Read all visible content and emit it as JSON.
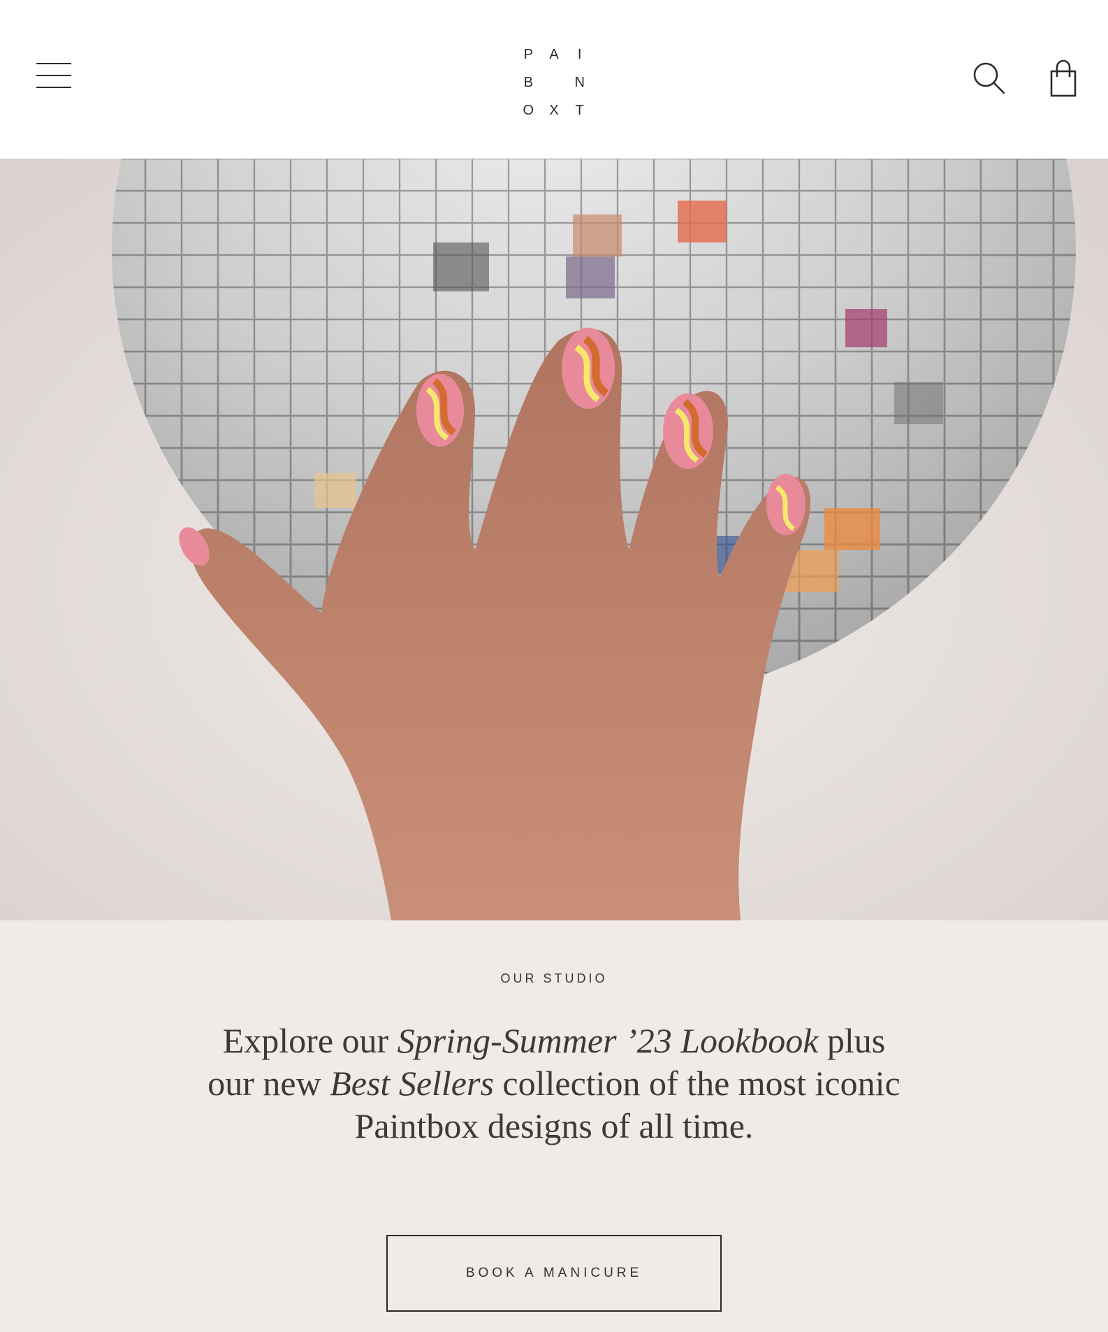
{
  "header": {
    "logo_letters": [
      "P",
      "A",
      "I",
      "B",
      "",
      "N",
      "O",
      "X",
      "T"
    ],
    "menu_icon": "hamburger-icon",
    "search_icon": "search-icon",
    "cart_icon": "shopping-bag-icon"
  },
  "hero": {
    "image_description": "hand with swirled pink, orange and yellow nail art holding a mirrored disco ball"
  },
  "studio": {
    "eyebrow": "OUR STUDIO",
    "headline_part1": "Explore our ",
    "headline_italic1": "Spring-Summer ’23 Lookbook",
    "headline_part2": " plus our new ",
    "headline_italic2": "Best Sellers",
    "headline_part3": " collection of the most iconic Paintbox designs of all time.",
    "cta_label": "BOOK A MANICURE"
  },
  "colors": {
    "text": "#2b2b2b",
    "studio_bg": "#f0ebe7",
    "header_bg": "#ffffff"
  }
}
